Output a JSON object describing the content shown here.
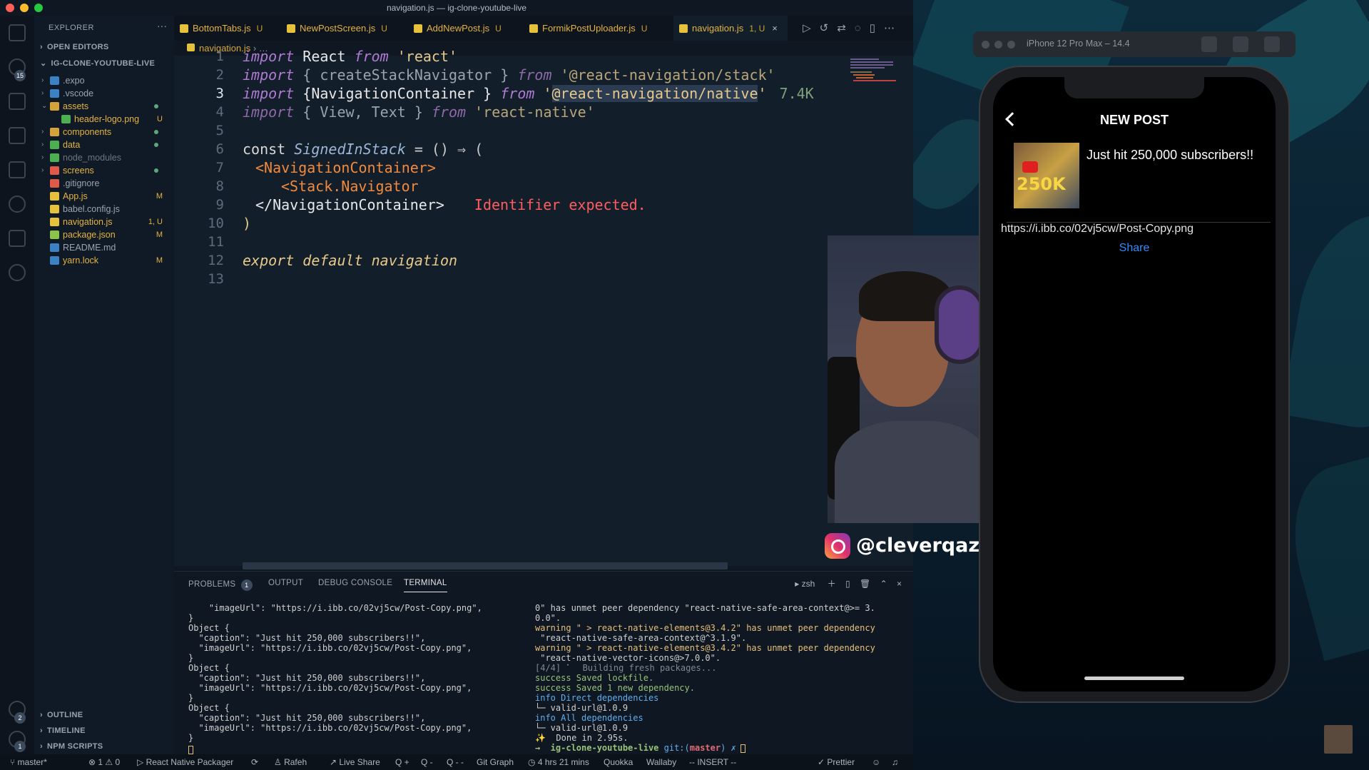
{
  "window_title": "navigation.js — ig-clone-youtube-live",
  "activity_badges": [
    "15",
    "2",
    "1"
  ],
  "explorer": {
    "title": "EXPLORER",
    "more": "···",
    "open_editors": "OPEN EDITORS",
    "project": "IG-CLONE-YOUTUBE-LIVE",
    "items": [
      {
        "name": ".expo",
        "status": "",
        "color": "#9aa3ad"
      },
      {
        "name": ".vscode",
        "status": "",
        "color": "#9aa3ad"
      },
      {
        "name": "assets",
        "status": "",
        "color": "#e3b341"
      },
      {
        "name": "header-logo.png",
        "status": "U",
        "color": "#e3b341"
      },
      {
        "name": "components",
        "status": "",
        "color": "#e3b341"
      },
      {
        "name": "data",
        "status": "",
        "color": "#e3b341"
      },
      {
        "name": "node_modules",
        "status": "",
        "color": "#6b7480"
      },
      {
        "name": "screens",
        "status": "",
        "color": "#e3b341"
      },
      {
        "name": ".gitignore",
        "status": "",
        "color": "#9aa3ad"
      },
      {
        "name": "App.js",
        "status": "M",
        "color": "#e3b341"
      },
      {
        "name": "babel.config.js",
        "status": "",
        "color": "#9aa3ad"
      },
      {
        "name": "navigation.js",
        "status": "1, U",
        "color": "#e3b341"
      },
      {
        "name": "package.json",
        "status": "M",
        "color": "#e3b341"
      },
      {
        "name": "README.md",
        "status": "",
        "color": "#9aa3ad"
      },
      {
        "name": "yarn.lock",
        "status": "M",
        "color": "#e3b341"
      }
    ],
    "outline": "OUTLINE",
    "timeline": "TIMELINE",
    "npm_scripts": "NPM SCRIPTS"
  },
  "tabs": [
    {
      "name": "BottomTabs.js",
      "status": "U"
    },
    {
      "name": "NewPostScreen.js",
      "status": "U"
    },
    {
      "name": "AddNewPost.js",
      "status": "U"
    },
    {
      "name": "FormikPostUploader.js",
      "status": "U"
    },
    {
      "name": "navigation.js",
      "status": "1, U"
    }
  ],
  "breadcrumb": {
    "file": "navigation.js",
    "rest": "…"
  },
  "code": {
    "line1": {
      "kw": "import",
      "id": " React ",
      "from": "from",
      "str": " 'react'"
    },
    "line2": {
      "kw": "import",
      "a": " { createStackNavigator } ",
      "from": "from",
      "str": " '@react-navigation/stack'"
    },
    "line3": {
      "kw": "import",
      "a": " {NavigationContainer } ",
      "from": "from",
      "q": " '",
      "sel": "@react-navigation/native",
      "q2": "'",
      "size": "7.4K"
    },
    "line4": {
      "kw": "import",
      "a": " { View, Text } ",
      "from": "from",
      "str": " 'react-native'"
    },
    "line6": {
      "const": "const ",
      "fn": "SignedInStack",
      "rest": " = () ⇒ ("
    },
    "line7": {
      "tag": "<NavigationContainer>"
    },
    "line8": {
      "tag": "<Stack.Navigator"
    },
    "line9": {
      "tag": "</NavigationContainer>",
      "error": "Identifier expected."
    },
    "line10": {
      "text": ")"
    },
    "line12": {
      "text": "export default navigation"
    },
    "line_numbers": [
      "1",
      "2",
      "3",
      "4",
      "5",
      "6",
      "7",
      "8",
      "9",
      "10",
      "11",
      "12",
      "13"
    ]
  },
  "panel": {
    "tabs": [
      "PROBLEMS",
      "OUTPUT",
      "DEBUG CONSOLE",
      "TERMINAL"
    ],
    "problems_count": "1",
    "shell": "zsh",
    "left_terminal": "    \"imageUrl\": \"https://i.ibb.co/02vj5cw/Post-Copy.png\",\n}\nObject {\n  \"caption\": \"Just hit 250,000 subscribers!!\",\n  \"imageUrl\": \"https://i.ibb.co/02vj5cw/Post-Copy.png\",\n}\nObject {\n  \"caption\": \"Just hit 250,000 subscribers!!\",\n  \"imageUrl\": \"https://i.ibb.co/02vj5cw/Post-Copy.png\",\n}\nObject {\n  \"caption\": \"Just hit 250,000 subscribers!!\",\n  \"imageUrl\": \"https://i.ibb.co/02vj5cw/Post-Copy.png\",\n}",
    "right_lines": [
      {
        "text": "0\" has unmet peer dependency \"react-native-safe-area-context@>= 3.",
        "cls": ""
      },
      {
        "text": "0.0\".",
        "cls": ""
      },
      {
        "text": "warning \" > react-native-elements@3.4.2\" has unmet peer dependency",
        "cls": "t-warn"
      },
      {
        "text": " \"react-native-safe-area-context@^3.1.9\".",
        "cls": ""
      },
      {
        "text": "warning \" > react-native-elements@3.4.2\" has unmet peer dependency",
        "cls": "t-warn"
      },
      {
        "text": " \"react-native-vector-icons@>7.0.0\".",
        "cls": ""
      },
      {
        "text": "[4/4] ⠁  Building fresh packages...",
        "cls": "t-dim"
      },
      {
        "text": "success Saved lockfile.",
        "cls": "t-succ"
      },
      {
        "text": "success Saved 1 new dependency.",
        "cls": "t-succ"
      },
      {
        "text": "info Direct dependencies",
        "cls": "t-info"
      },
      {
        "text": "└─ valid-url@1.0.9",
        "cls": ""
      },
      {
        "text": "info All dependencies",
        "cls": "t-info"
      },
      {
        "text": "└─ valid-url@1.0.9",
        "cls": ""
      },
      {
        "text": "✨  Done in 2.95s.",
        "cls": ""
      }
    ],
    "prompt_dir": "→  ig-clone-youtube-live",
    "prompt_git": " git:(",
    "prompt_branch": "master",
    "prompt_end": ") ✗"
  },
  "status": {
    "branch": "master*",
    "problems": "⊗ 1 ⚠ 0",
    "packager": "React Native Packager",
    "user": "Rafeh",
    "live_share": "Live Share",
    "q1": "Q +",
    "q2": "Q -",
    "q3": "Q - -",
    "git_graph": "Git Graph",
    "time": "4 hrs 21 mins",
    "quokka": "Quokka",
    "wallaby": "Wallaby",
    "mode": "-- INSERT --",
    "prettier": "Prettier"
  },
  "overlay": {
    "instagram": "@cleverqazi"
  },
  "simulator": {
    "title": "iPhone 12 Pro Max – 14.4",
    "screen_title": "NEW POST",
    "thumb_text": "250K",
    "caption": "Just hit 250,000 subscribers!!",
    "url": "https://i.ibb.co/02vj5cw/Post-Copy.png",
    "share": "Share"
  }
}
